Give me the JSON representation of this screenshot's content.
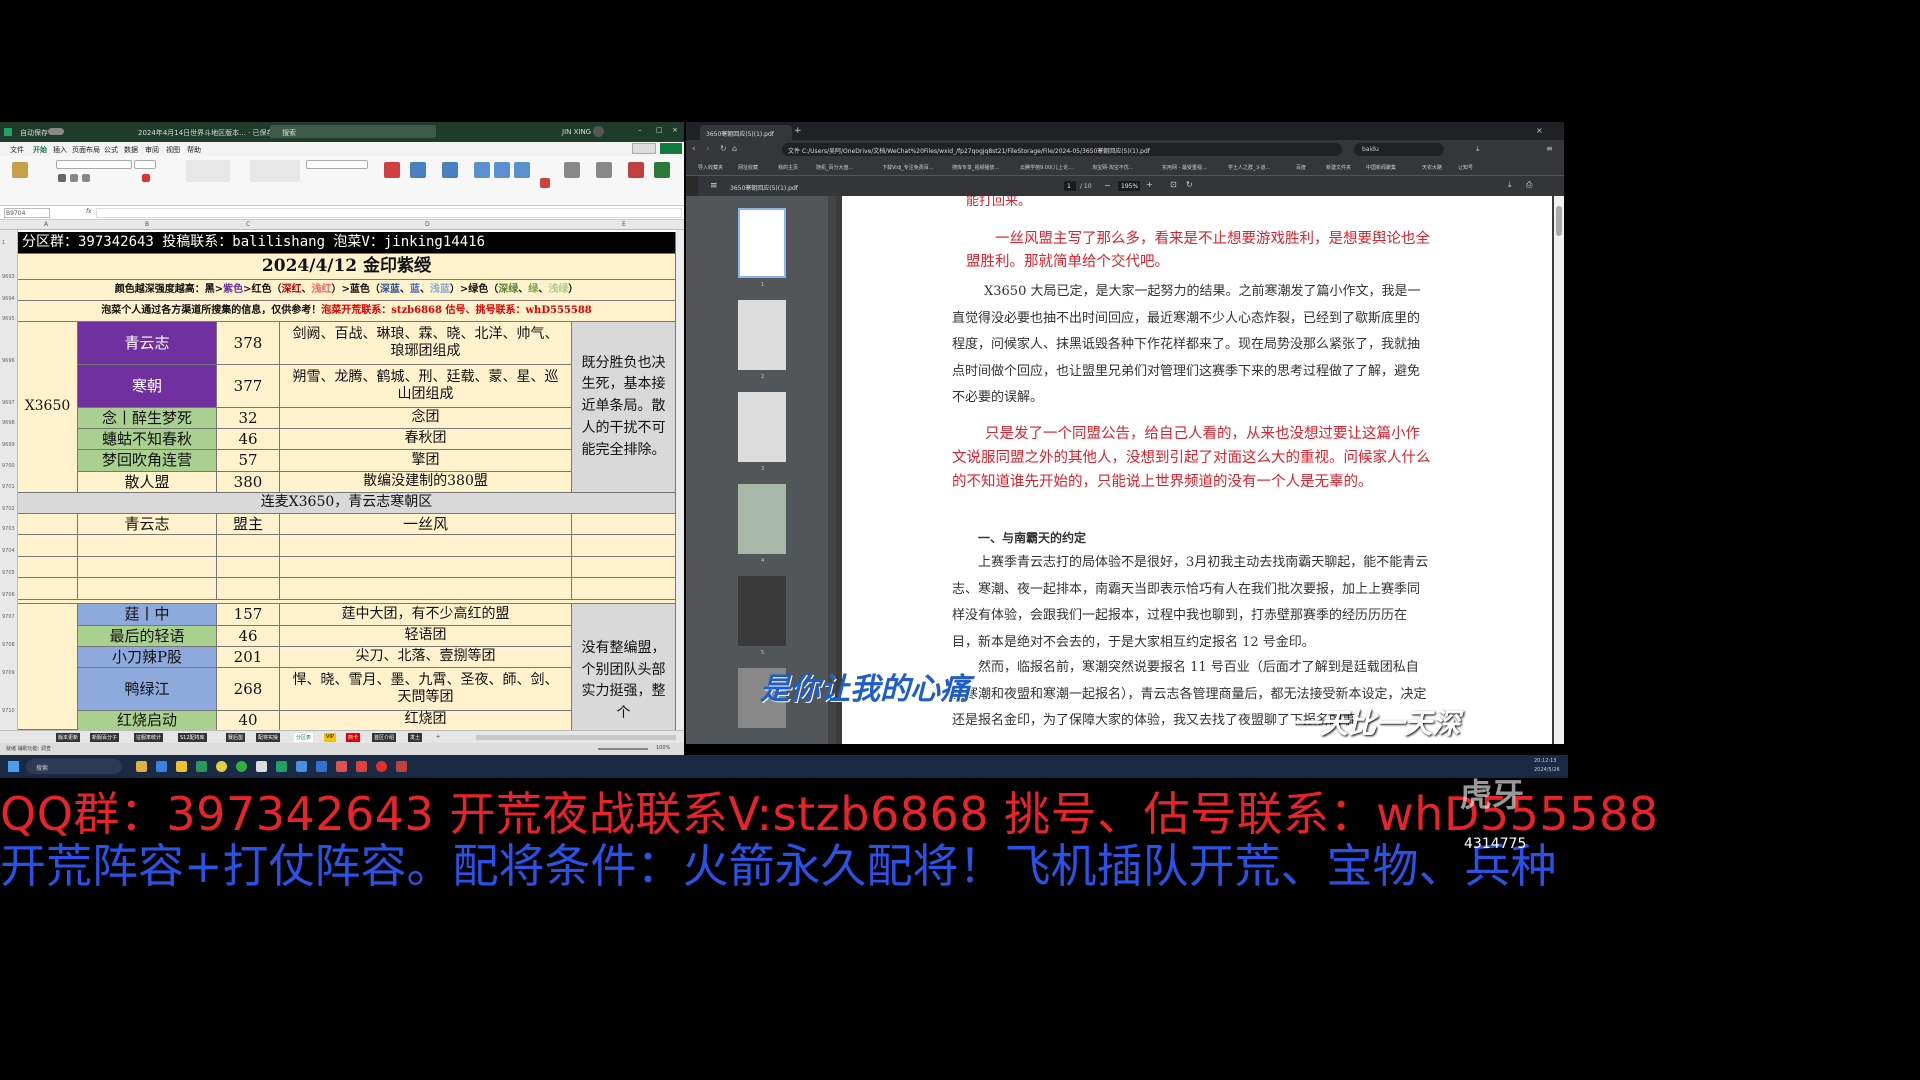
{
  "excel": {
    "title_bar": {
      "autosave": "自动保存",
      "filename": "2024年4月14日世界斗地区版本... · 已保存",
      "search": "搜索",
      "user": "JIN XING"
    },
    "menu": [
      "文件",
      "开始",
      "插入",
      "页面布局",
      "公式",
      "数据",
      "审阅",
      "视图",
      "帮助"
    ],
    "name_box": "B9704",
    "col_headers": [
      "A",
      "B",
      "C",
      "D",
      "E"
    ],
    "row_headers": [
      "1",
      "9693",
      "9694",
      "9695",
      "9696",
      "9697",
      "9698",
      "9699",
      "9700",
      "9701",
      "9702",
      "9703",
      "9704",
      "9705",
      "9706",
      "9707",
      "9708",
      "9709",
      "9710"
    ],
    "banner": "分区群：397342643 投稿联系：balilishang 泡菜V：jinking14416",
    "date_title": "2024/4/12  金印紫绶",
    "legend": {
      "prefix": "颜色越深强度越高：黑>",
      "purple": "紫色",
      "mid1": ">红色（",
      "r1": "深红",
      "c1": "、",
      "r2": "浅红",
      "mid2": "）>蓝色（",
      "b1": "深蓝",
      "c2": "、",
      "b2": "蓝",
      "c3": "、",
      "b3": "浅蓝",
      "mid3": "）>绿色（",
      "g1": "深绿",
      "c4": "、",
      "g2": "绿",
      "c5": "、",
      "g3": "浅绿",
      "end": "）"
    },
    "notice": {
      "black": "泡菜个人通过各方渠道所搜集的信息，仅供参考！",
      "red": "泡菜开荒联系：stzb6868  估号、挑号联系：whD555588"
    },
    "region1": {
      "name": "X3650",
      "rows": [
        {
          "alliance": "青云志",
          "count": "378",
          "desc": "剑阙、百战、琳琅、霖、晓、北洋、帅气、琅琊团组成"
        },
        {
          "alliance": "寒朝",
          "count": "377",
          "desc": "朔雪、龙腾、鹤城、刑、廷载、蒙、星、巡山团组成"
        },
        {
          "alliance": "念丨醉生梦死",
          "count": "32",
          "desc": "念团"
        },
        {
          "alliance": "蟪蛄不知春秋",
          "count": "46",
          "desc": "春秋团"
        },
        {
          "alliance": "梦回吹角连营",
          "count": "57",
          "desc": "擎团"
        },
        {
          "alliance": "散人盟",
          "count": "380",
          "desc": "散编没建制的380盟"
        }
      ],
      "comment": "既分胜负也决生死，基本接近单条局。散人的干扰不可能完全排除。"
    },
    "connect_row": "连麦X3650，青云志寒朝区",
    "leader_row": {
      "alliance": "青云志",
      "role": "盟主",
      "name": "一丝风"
    },
    "region2": {
      "rows": [
        {
          "alliance": "莛丨中",
          "count": "157",
          "desc": "莛中大团，有不少高红的盟"
        },
        {
          "alliance": "最后的轻语",
          "count": "46",
          "desc": "轻语团"
        },
        {
          "alliance": "小刀辣P股",
          "count": "201",
          "desc": "尖刀、北落、壹捌等团"
        },
        {
          "alliance": "鸭绿江",
          "count": "268",
          "desc": "悍、晓、雪月、墨、九霄、圣夜、師、剑、天問等团"
        },
        {
          "alliance": "红烧启动",
          "count": "40",
          "desc": "红烧团"
        }
      ],
      "comment": "没有整编盟，个别团队头部实力挺强，整个"
    },
    "sheet_tabs": [
      "版本更新",
      "新服百分子",
      "征服率统计",
      "S12配将库",
      "赛后盟",
      "配将实操",
      "分区表",
      "VIP",
      "商卡",
      "首区介绍",
      "发土",
      "+"
    ],
    "status": "就绪  辅助功能: 调查",
    "zoom": "100%"
  },
  "browser": {
    "tab_title": "3650寒朝回应(5)(1).pdf",
    "url": "C:/Users/吴阿/OneDrive/文档/WeChat%20Files/wxid_/fp27qogjq8st21/FileStorage/File/2024-05/3650寒朝回应(5)(1).pdf",
    "file_label": "文件",
    "search": "baidu",
    "bookmarks": [
      "导入收藏夹",
      "网址收藏",
      "我的主页",
      "随机_百分大盘...",
      "下载Vidj_专注免费百...",
      "搜库专享_视频播放...",
      "云腾学苑9.00(儿上论...",
      "淘宝网-淘宝不优...",
      "实用网 - 最受重视...",
      "学土人之群_斗道...",
      "百度",
      "新建文件夹",
      "中国新闻聚集",
      "天农大路",
      "让知号"
    ],
    "pdf_name": "3650寒朝回应(5)(1).pdf",
    "page": "1",
    "page_total": "/ 10",
    "zoom": "195%",
    "thumb_labels": [
      "1",
      "2",
      "3",
      "4",
      "5"
    ],
    "paragraphs": {
      "p0": "能打回来。",
      "p1": "一丝风盟主写了那么多，看来是不止想要游戏胜利，是想要舆论也全盟胜利。那就简单给个交代吧。",
      "p2": "X3650 大局已定，是大家一起努力的结果。之前寒潮发了篇小作文，我是一直觉得没必要也抽不出时间回应，最近寒潮不少人心态炸裂，已经到了歇斯底里的程度，问候家人、抹黑诋毁各种下作花样都来了。现在局势没那么紧张了，我就抽点时间做个回应，也让盟里兄弟们对管理们这赛季下来的思考过程做了了解，避免不必要的误解。",
      "p3": "只是发了一个同盟公告，给自己人看的，从来也没想过要让这篇小作文说服同盟之外的其他人，没想到引起了对面这么大的重视。问候家人什么的不知道谁先开始的，只能说上世界频道的没有一个人是无辜的。",
      "h1": "一、与南霸天的约定",
      "p4": "上赛季青云志打的局体验不是很好，3月初我主动去找南霸天聊起，能不能青云志、寒潮、夜一起排本，南霸天当即表示恰巧有人在我们批次要报，加上上赛季同样没有体验，会跟我们一起报本，过程中我也聊到，打赤壁那赛季的经历历历在目，新本是绝对不会去的，于是大家相互约定报名 12 号金印。",
      "p5": "然而，临报名前，寒潮突然说要报名 11 号百业（后面才了解到是廷载团私自找寒潮和夜盟和寒潮一起报名），青云志各管理商量后，都无法接受新本设定，决定还是报名金印，为了保障大家的体验，我又去找了夜盟聊了下报名的事"
    },
    "subtitle1": "是你让我的心痛",
    "subtitle2": "一天比一天深"
  },
  "overlay": {
    "line1": "QQ群：397342643  开荒夜战联系V:stzb6868  挑号、估号联系：whD555588",
    "line2": "开荒阵容+打仗阵容。配将条件：火箭永久配将！飞机插队开荒、宝物、兵种",
    "watermark": "虎牙",
    "room": "4314775"
  },
  "taskbar": {
    "search": "搜索",
    "time": "20:12:13",
    "date": "2024/5/26"
  }
}
